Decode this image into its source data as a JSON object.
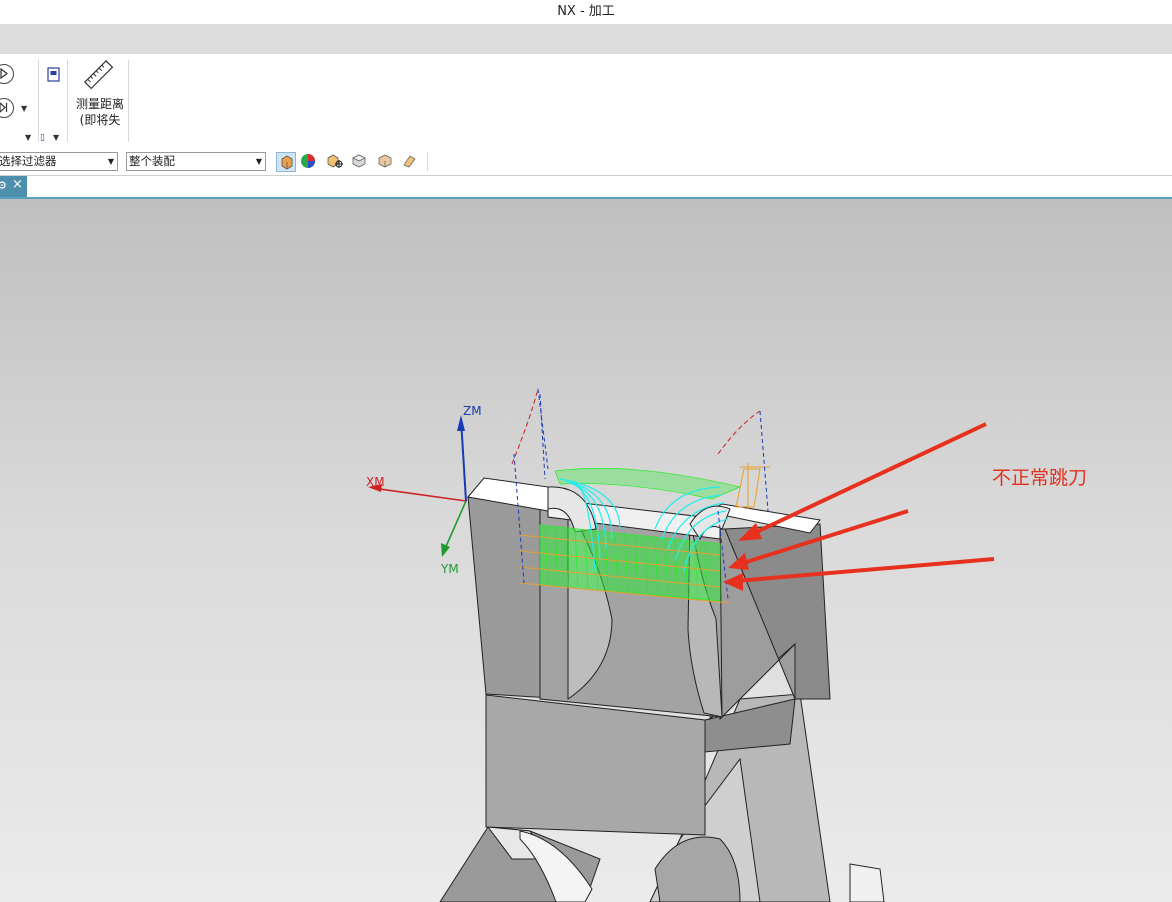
{
  "window": {
    "title": "NX - 加工"
  },
  "ribbon": {
    "measure_label_line1": "测量距离",
    "measure_label_line2": "(即将失"
  },
  "filterbar": {
    "selection_filter": "选择过滤器",
    "scope": "整个装配"
  },
  "tabs": {
    "close_glyph": "×"
  },
  "viewport": {
    "annotation": "不正常跳刀",
    "wcs": {
      "x_label": "XM",
      "y_label": "YM",
      "z_label": "ZM"
    },
    "colors": {
      "annotation_red": "#e0321e",
      "toolpath_green": "#22ee22",
      "toolpath_cyan": "#22eeee",
      "x_axis": "#cc2222",
      "y_axis": "#229933",
      "z_axis": "#1a3ab5"
    },
    "icons": [
      "wcs-triad-icon",
      "red-arrow-icon"
    ]
  }
}
